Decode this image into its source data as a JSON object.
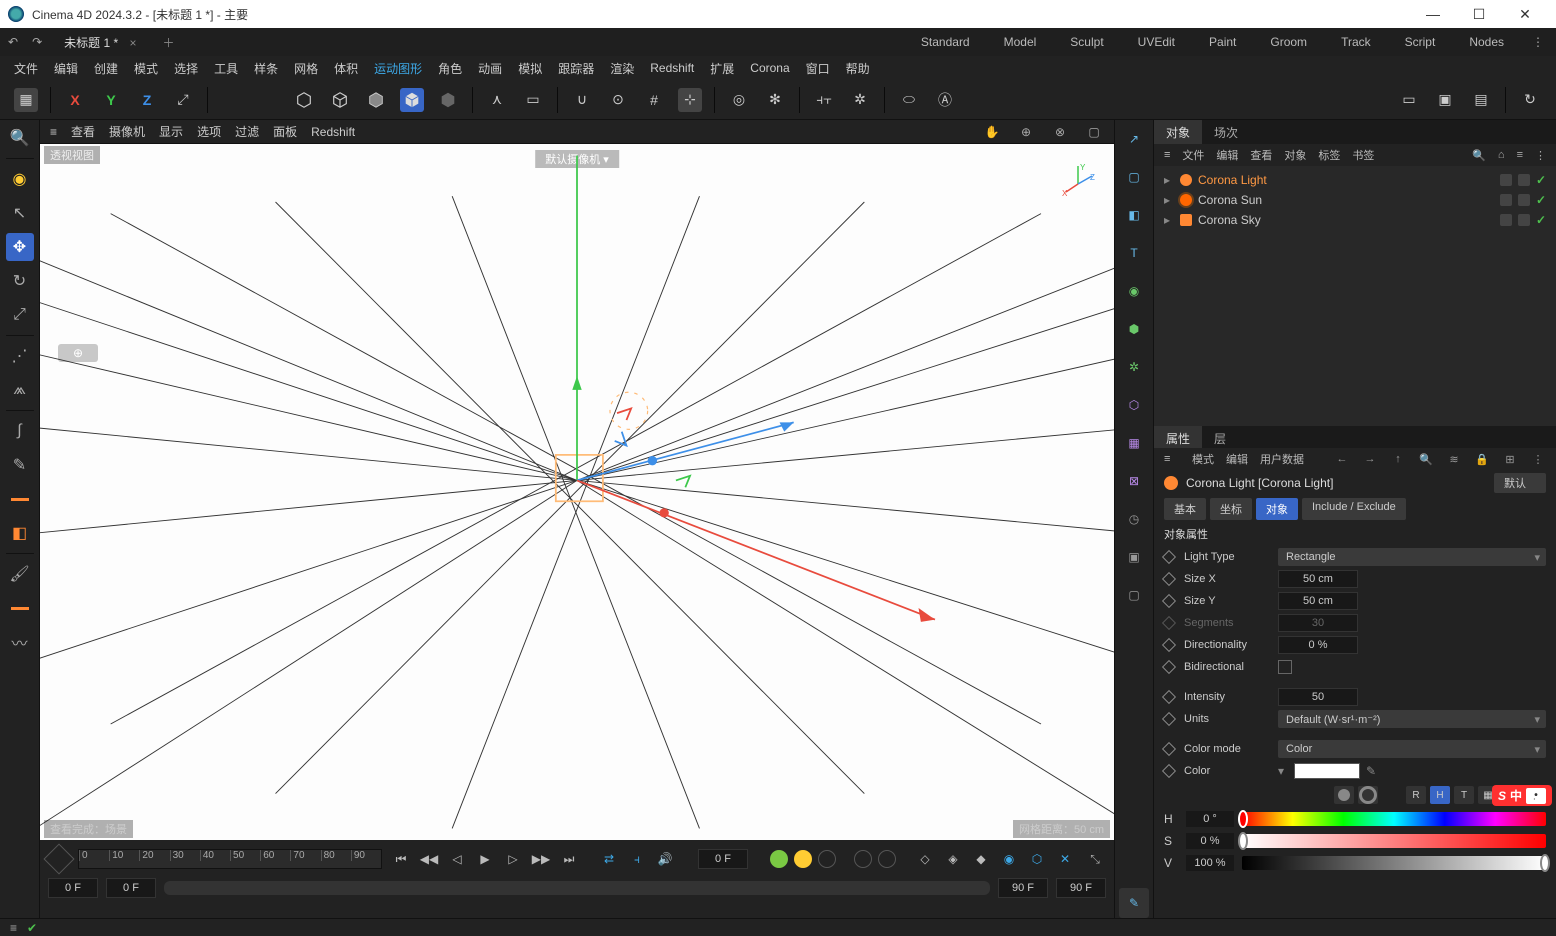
{
  "titlebar": {
    "title": "Cinema 4D 2024.3.2 - [未标题 1 *] - 主要"
  },
  "winctl": {
    "min": "—",
    "max": "☐",
    "close": "✕"
  },
  "nav": {
    "undo": "↶",
    "redo": "↷",
    "doc": "未标题 1 *",
    "doc_close": "×",
    "plus": "＋",
    "menu_dots": "⋮"
  },
  "modes": [
    "Standard",
    "Model",
    "Sculpt",
    "UVEdit",
    "Paint",
    "Groom",
    "Track",
    "Script",
    "Nodes"
  ],
  "menubar": [
    "文件",
    "编辑",
    "创建",
    "模式",
    "选择",
    "工具",
    "样条",
    "网格",
    "体积",
    "运动图形",
    "角色",
    "动画",
    "模拟",
    "跟踪器",
    "渲染",
    "Redshift",
    "扩展",
    "Corona",
    "窗口",
    "帮助"
  ],
  "menubar_highlight_index": 9,
  "axes": {
    "x": "X",
    "y": "Y",
    "z": "Z"
  },
  "vp_menu": [
    "≡",
    "查看",
    "摄像机",
    "显示",
    "选项",
    "过滤",
    "面板",
    "Redshift"
  ],
  "vp": {
    "label": "透视视图",
    "camera": "默认摄像机 ▾",
    "footer_left": "查看完成：场景",
    "footer_right": "网格距离：50 cm",
    "snap": "⊕"
  },
  "timeline": {
    "ticks": [
      "0",
      "10",
      "20",
      "30",
      "40",
      "50",
      "60",
      "70",
      "80",
      "90"
    ],
    "start": "0 F",
    "range_start": "0 F",
    "range_end": "90 F",
    "end": "90 F",
    "cur": "0 F"
  },
  "obj_panel": {
    "tabs": [
      "对象",
      "场次"
    ],
    "menu": [
      "≡",
      "文件",
      "编辑",
      "查看",
      "对象",
      "标签",
      "书签"
    ],
    "icons": [
      "🔍",
      "⌂",
      "≡",
      "⋮"
    ]
  },
  "objects": [
    {
      "icon": "bulb",
      "name": "Corona Light",
      "selected": true
    },
    {
      "icon": "sun",
      "name": "Corona Sun",
      "selected": false
    },
    {
      "icon": "sky",
      "name": "Corona Sky",
      "selected": false
    }
  ],
  "attr_panel": {
    "tabs": [
      "属性",
      "层"
    ],
    "menu": [
      "模式",
      "编辑",
      "用户数据"
    ],
    "nav_icons": [
      "←",
      "→",
      "↑",
      "🔍",
      "≋",
      "🔒",
      "⊞",
      "⋮"
    ],
    "object_name": "Corona Light [Corona Light]",
    "default_label": "默认",
    "subtabs": [
      "基本",
      "坐标",
      "对象",
      "Include / Exclude"
    ],
    "active_subtab": 2,
    "group_title": "对象属性",
    "light_type_label": "Light Type",
    "light_type_value": "Rectangle",
    "size_x_label": "Size X",
    "size_x_value": "50 cm",
    "size_y_label": "Size Y",
    "size_y_value": "50 cm",
    "segments_label": "Segments",
    "segments_value": "30",
    "directionality_label": "Directionality",
    "directionality_value": "0 %",
    "bidirectional_label": "Bidirectional",
    "intensity_label": "Intensity",
    "intensity_value": "50",
    "units_label": "Units",
    "units_value": "Default (W·sr¹·m⁻²)",
    "color_mode_label": "Color mode",
    "color_mode_value": "Color",
    "color_label": "Color",
    "hsv": {
      "h_label": "H",
      "h_value": "0 °",
      "s_label": "S",
      "s_value": "0 %",
      "v_label": "V",
      "v_value": "100 %"
    },
    "color_mode_btns": [
      "R",
      "H",
      "T",
      "▦",
      "#",
      "⊞"
    ]
  },
  "ime": {
    "logo": "S",
    "text": "中",
    "ext": "•ְ"
  }
}
